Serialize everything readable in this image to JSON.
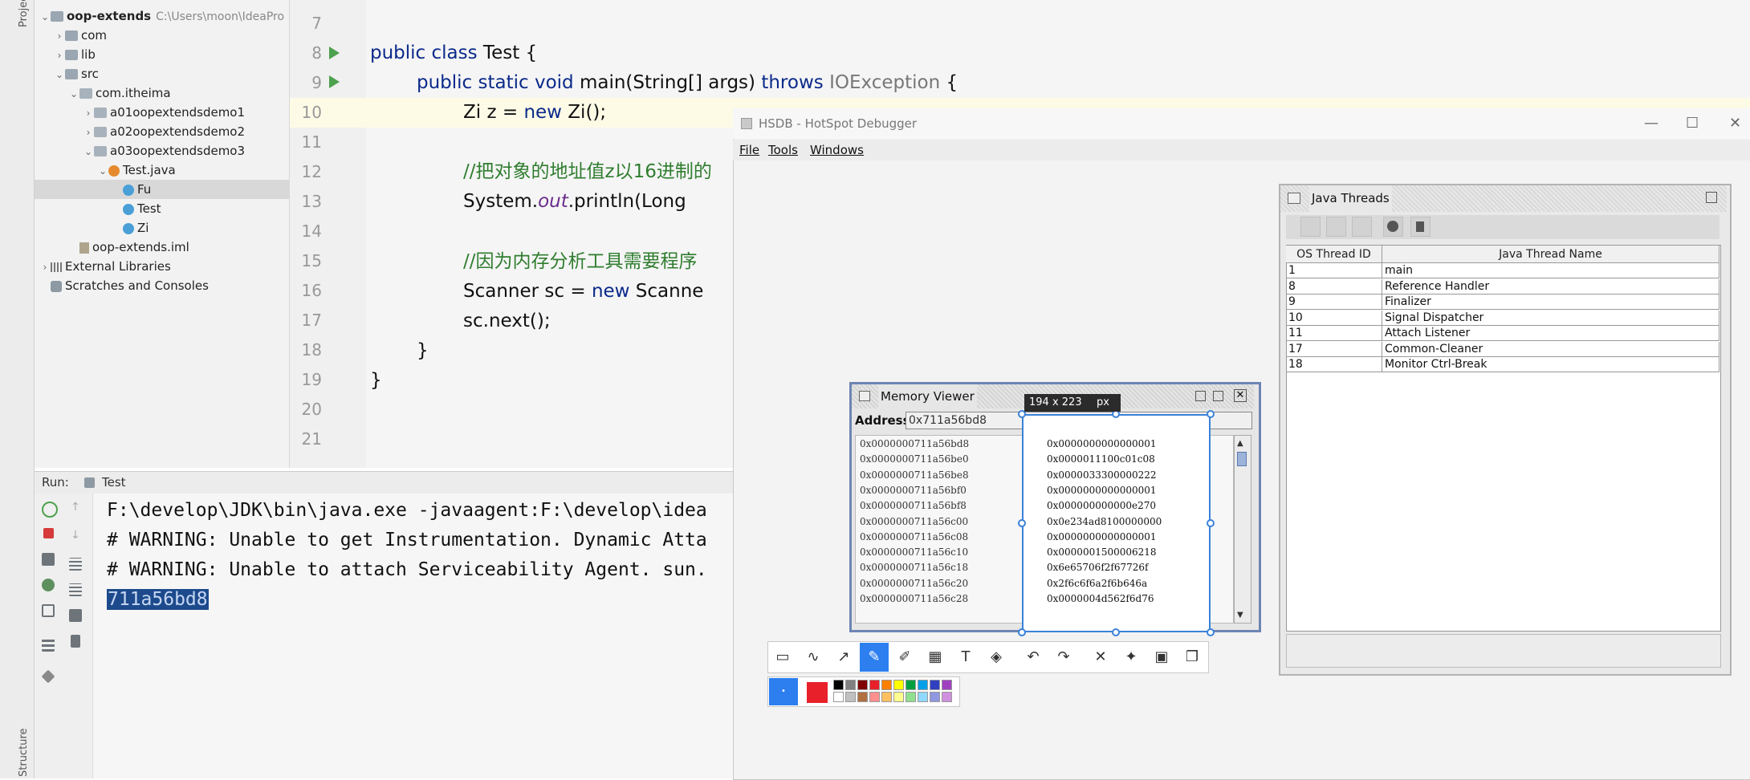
{
  "ide": {
    "side_labels": {
      "project": "Project",
      "structure": "Structure"
    },
    "tree": [
      {
        "label": "oop-extends",
        "hint": "C:\\Users\\moon\\IdeaPro",
        "icon": "folder",
        "arrow": "open",
        "indent": 0,
        "bold": true
      },
      {
        "label": "com",
        "icon": "folder",
        "arrow": "closed",
        "indent": 1
      },
      {
        "label": "lib",
        "icon": "folder",
        "arrow": "closed",
        "indent": 1
      },
      {
        "label": "src",
        "icon": "folder",
        "arrow": "open",
        "indent": 1
      },
      {
        "label": "com.itheima",
        "icon": "package",
        "arrow": "open",
        "indent": 2
      },
      {
        "label": "a01oopextendsdemo1",
        "icon": "package",
        "arrow": "closed",
        "indent": 3
      },
      {
        "label": "a02oopextendsdemo2",
        "icon": "package",
        "arrow": "closed",
        "indent": 3
      },
      {
        "label": "a03oopextendsdemo3",
        "icon": "package",
        "arrow": "open",
        "indent": 3
      },
      {
        "label": "Test.java",
        "icon": "java-file",
        "arrow": "open",
        "indent": 4
      },
      {
        "label": "Fu",
        "icon": "class",
        "arrow": "",
        "indent": 5,
        "selected": true
      },
      {
        "label": "Test",
        "icon": "class",
        "arrow": "",
        "indent": 5
      },
      {
        "label": "Zi",
        "icon": "class",
        "arrow": "",
        "indent": 5
      },
      {
        "label": "oop-extends.iml",
        "icon": "iml",
        "arrow": "",
        "indent": 2
      },
      {
        "label": "External Libraries",
        "icon": "libraries",
        "arrow": "closed",
        "indent": 0
      },
      {
        "label": "Scratches and Consoles",
        "icon": "scratches",
        "arrow": "",
        "indent": 0
      }
    ],
    "editor_lines": [
      "7",
      "8",
      "9",
      "10",
      "11",
      "12",
      "13",
      "14",
      "15",
      "16",
      "17",
      "18",
      "19",
      "20",
      "21"
    ],
    "code": {
      "l8": {
        "kw": "public class ",
        "rest": "Test {"
      },
      "l9": {
        "kw1": "public static void ",
        "mid": "main(String[] args) ",
        "kw2": "throws ",
        "ty": "IOException",
        "end": " {"
      },
      "l10": {
        "a": "Zi z = ",
        "kw": "new ",
        "b": "Zi();"
      },
      "l12": "//把对象的地址值z以16进制的",
      "l13": {
        "a": "System.",
        "it": "out",
        "b": ".println(Long"
      },
      "l15": "//因为内存分析工具需要程序",
      "l16": {
        "a": "Scanner sc = ",
        "kw": "new ",
        "b": "Scanne"
      },
      "l17": "sc.next();",
      "l18": "}",
      "l19": "}"
    },
    "run": {
      "label": "Run:",
      "tab": "Test",
      "console": [
        "F:\\develop\\JDK\\bin\\java.exe -javaagent:F:\\develop\\idea",
        "# WARNING: Unable to get Instrumentation. Dynamic Atta",
        "# WARNING: Unable to attach Serviceability Agent. sun.",
        "711a56bd8"
      ]
    }
  },
  "hsdb": {
    "title": "HSDB - HotSpot Debugger",
    "menu": [
      "File",
      "Tools",
      "Windows"
    ],
    "threads": {
      "title": "Java Threads",
      "columns": [
        "OS Thread ID",
        "Java Thread Name"
      ],
      "rows": [
        [
          "1",
          "main"
        ],
        [
          "8",
          "Reference Handler"
        ],
        [
          "9",
          "Finalizer"
        ],
        [
          "10",
          "Signal Dispatcher"
        ],
        [
          "11",
          "Attach Listener"
        ],
        [
          "17",
          "Common-Cleaner"
        ],
        [
          "18",
          "Monitor Ctrl-Break"
        ]
      ]
    },
    "memory": {
      "title": "Memory Viewer",
      "address_label": "Address:",
      "address_value": "0x711a56bd8",
      "rows": [
        [
          "0x0000000711a56bd8",
          "0x0000000000000001"
        ],
        [
          "0x0000000711a56be0",
          "0x0000011100c01c08"
        ],
        [
          "0x0000000711a56be8",
          "0x0000033300000222"
        ],
        [
          "0x0000000711a56bf0",
          "0x0000000000000001"
        ],
        [
          "0x0000000711a56bf8",
          "0x000000000000e270"
        ],
        [
          "0x0000000711a56c00",
          "0x0e234ad8100000000"
        ],
        [
          "0x0000000711a56c08",
          "0x0000000000000001"
        ],
        [
          "0x0000000711a56c10",
          "0x0000001500006218"
        ],
        [
          "0x0000000711a56c18",
          "0x6e65706f2f67726f"
        ],
        [
          "0x0000000711a56c20",
          "0x2f6c6f6a2f6b646a"
        ],
        [
          "0x0000000711a56c28",
          "0x0000004d562f6d76"
        ]
      ]
    }
  },
  "snip": {
    "size_label": "194 x 223",
    "unit": "px",
    "tools": [
      "rect",
      "curve",
      "arrow",
      "pen",
      "marker",
      "mosaic",
      "text",
      "eraser",
      "undo",
      "redo",
      "cancel",
      "pin",
      "save",
      "copy"
    ],
    "current_color": "#e8202a"
  }
}
